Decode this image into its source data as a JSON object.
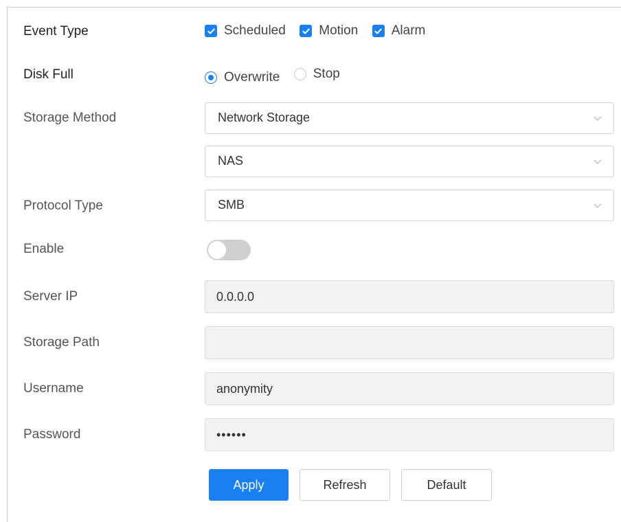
{
  "event_type": {
    "label": "Event Type",
    "options": [
      {
        "label": "Scheduled",
        "checked": true
      },
      {
        "label": "Motion",
        "checked": true
      },
      {
        "label": "Alarm",
        "checked": true
      }
    ]
  },
  "disk_full": {
    "label": "Disk Full",
    "options": [
      {
        "label": "Overwrite",
        "selected": true
      },
      {
        "label": "Stop",
        "selected": false
      }
    ]
  },
  "storage_method": {
    "label": "Storage Method",
    "value": "Network Storage",
    "sub_value": "NAS"
  },
  "protocol_type": {
    "label": "Protocol Type",
    "value": "SMB"
  },
  "enable": {
    "label": "Enable",
    "on": false
  },
  "server_ip": {
    "label": "Server IP",
    "value": "0.0.0.0"
  },
  "storage_path": {
    "label": "Storage Path",
    "value": ""
  },
  "username": {
    "label": "Username",
    "value": "anonymity"
  },
  "password": {
    "label": "Password",
    "value": "••••••"
  },
  "buttons": {
    "apply": "Apply",
    "refresh": "Refresh",
    "default": "Default"
  },
  "colors": {
    "accent": "#1a7ff0",
    "toggle_off": "#cfcfcf"
  }
}
